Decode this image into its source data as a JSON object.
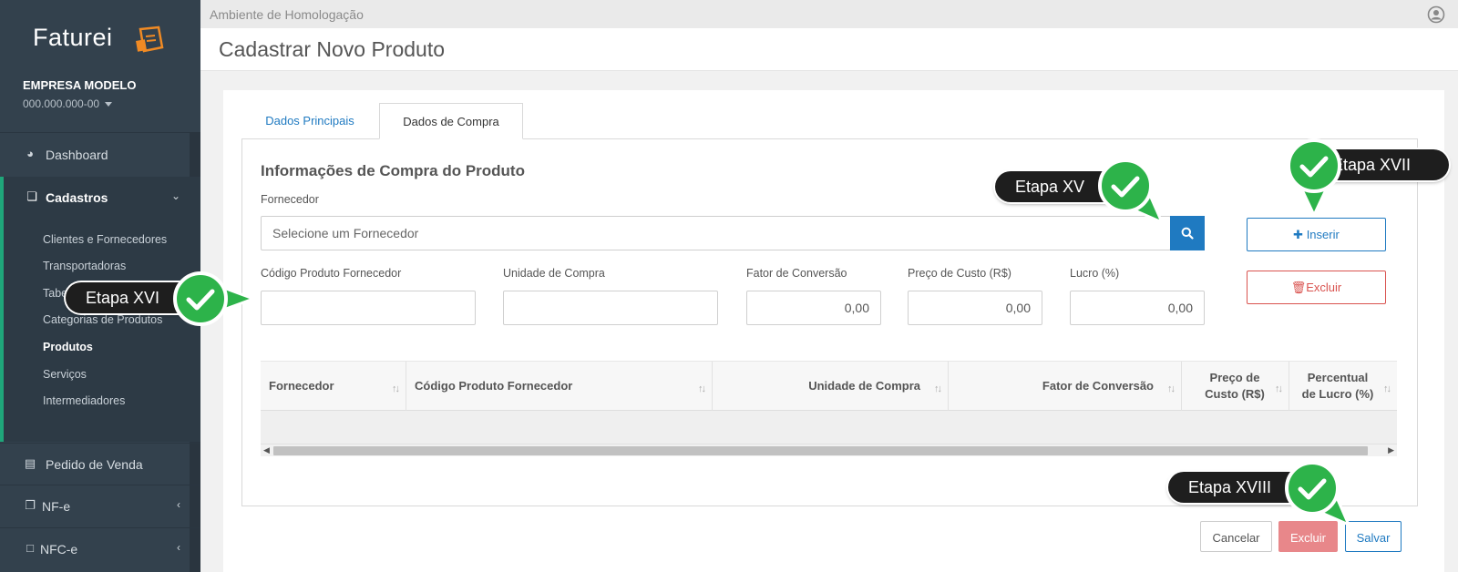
{
  "sidebar": {
    "logo": "Faturei",
    "company_name": "EMPRESA MODELO",
    "company_doc": "000.000.000-00",
    "nav": {
      "dashboard": "Dashboard",
      "cadastros": "Cadastros",
      "pedido": "Pedido de Venda",
      "nfe": "NF-e",
      "nfce": "NFC-e"
    },
    "submenu": [
      "Clientes e Fornecedores",
      "Transportadoras",
      "Tabe",
      "Categorias de Produtos",
      "Produtos",
      "Serviços",
      "Intermediadores"
    ]
  },
  "topbar": {
    "environment": "Ambiente de Homologação"
  },
  "page": {
    "title": "Cadastrar Novo Produto"
  },
  "tabs": {
    "principais": "Dados Principais",
    "compra": "Dados de Compra"
  },
  "form": {
    "section_title": "Informações de Compra do Produto",
    "fornecedor_label": "Fornecedor",
    "fornecedor_placeholder": "Selecione um Fornecedor",
    "codigo_label": "Código Produto Fornecedor",
    "unidade_label": "Unidade de Compra",
    "fator_label": "Fator de Conversão",
    "fator_value": "0,00",
    "preco_label": "Preço de Custo (R$)",
    "preco_value": "0,00",
    "lucro_label": "Lucro (%)",
    "lucro_value": "0,00"
  },
  "actions": {
    "inserir": "Inserir",
    "excluir": "Excluir"
  },
  "table": {
    "headers": {
      "fornecedor": "Fornecedor",
      "codigo": "Código Produto Fornecedor",
      "unidade": "Unidade de Compra",
      "fator": "Fator de Conversão",
      "preco_1": "Preço de",
      "preco_2": "Custo (R$)",
      "lucro_1": "Percentual",
      "lucro_2": "de Lucro (%)"
    }
  },
  "footer": {
    "cancelar": "Cancelar",
    "excluir": "Excluir",
    "salvar": "Salvar"
  },
  "annotations": {
    "xv": "Etapa XV",
    "xvi": "Etapa XVI",
    "xvii": "Etapa XVII",
    "xviii": "Etapa XVIII"
  },
  "colors": {
    "sidebar": "#33414d",
    "accent": "#1f7ac1",
    "danger": "#d9534f",
    "active_bar": "#1fa67a",
    "badge_green": "#2db34a"
  }
}
